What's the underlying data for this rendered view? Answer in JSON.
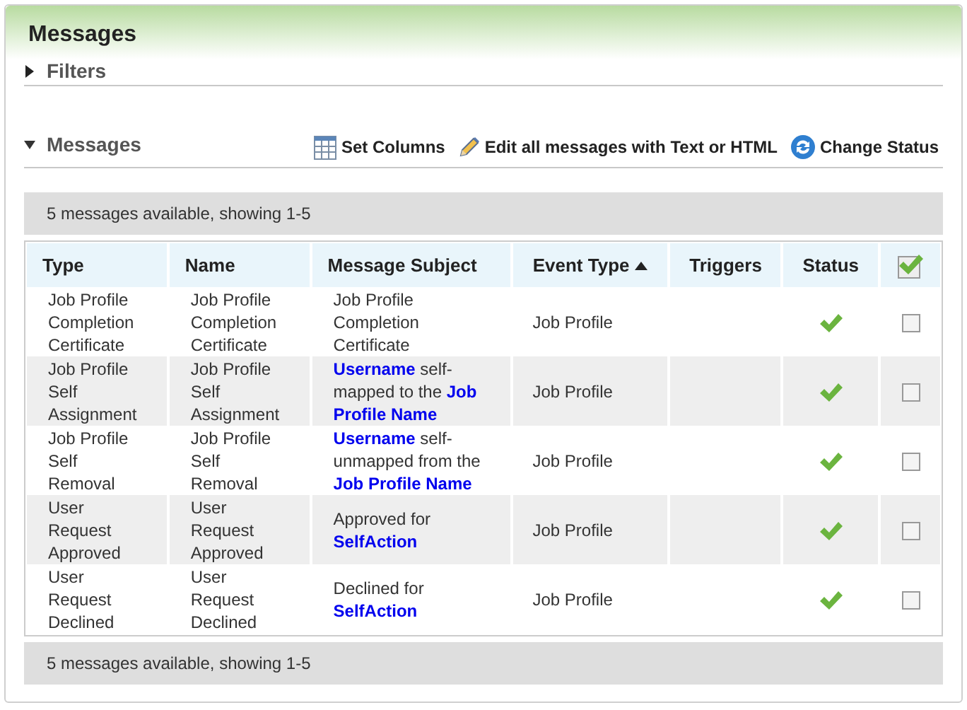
{
  "page_title": "Messages",
  "filters": {
    "label": "Filters",
    "expanded": false
  },
  "messages_section": {
    "label": "Messages",
    "expanded": true
  },
  "toolbar": [
    {
      "kind": "columns",
      "label": "Set Columns"
    },
    {
      "kind": "edit",
      "label": "Edit all messages with Text or HTML"
    },
    {
      "kind": "status",
      "label": "Change Status"
    }
  ],
  "pager_top": "5 messages available, showing 1-5",
  "columns": [
    {
      "label": "Type",
      "sorted": false
    },
    {
      "label": "Name",
      "sorted": false
    },
    {
      "label": "Message Subject",
      "sorted": false
    },
    {
      "label": "Event Type",
      "sorted": true
    },
    {
      "label": "Triggers",
      "sorted": false
    },
    {
      "label": "Status",
      "sorted": false
    }
  ],
  "select_all_checked": true,
  "rows": [
    {
      "type": "Job Profile Completion Certificate",
      "name": "Job Profile Completion Certificate",
      "subject": "Job Profile Completion Certificate",
      "event_type": "Job Profile",
      "active": true,
      "checked": false
    },
    {
      "type": "Job Profile Self Assignment",
      "name": "Job Profile Self Assignment",
      "subject": "**Username** self-mapped to the **Job Profile Name**",
      "event_type": "Job Profile",
      "active": true,
      "checked": false
    },
    {
      "type": "Job Profile Self Removal",
      "name": "Job Profile Self Removal",
      "subject": "**Username** self-unmapped from the **Job Profile Name**",
      "event_type": "Job Profile",
      "active": true,
      "checked": false
    },
    {
      "type": "User Request Approved",
      "name": "User Request Approved",
      "subject": "Approved for **SelfAction**",
      "event_type": "Job Profile",
      "active": true,
      "checked": false
    },
    {
      "type": "User Request Declined",
      "name": "User Request Declined",
      "subject": "Declined for **SelfAction**",
      "event_type": "Job Profile",
      "active": true,
      "checked": false
    }
  ],
  "pager_bottom": "5 messages available, showing 1-5"
}
